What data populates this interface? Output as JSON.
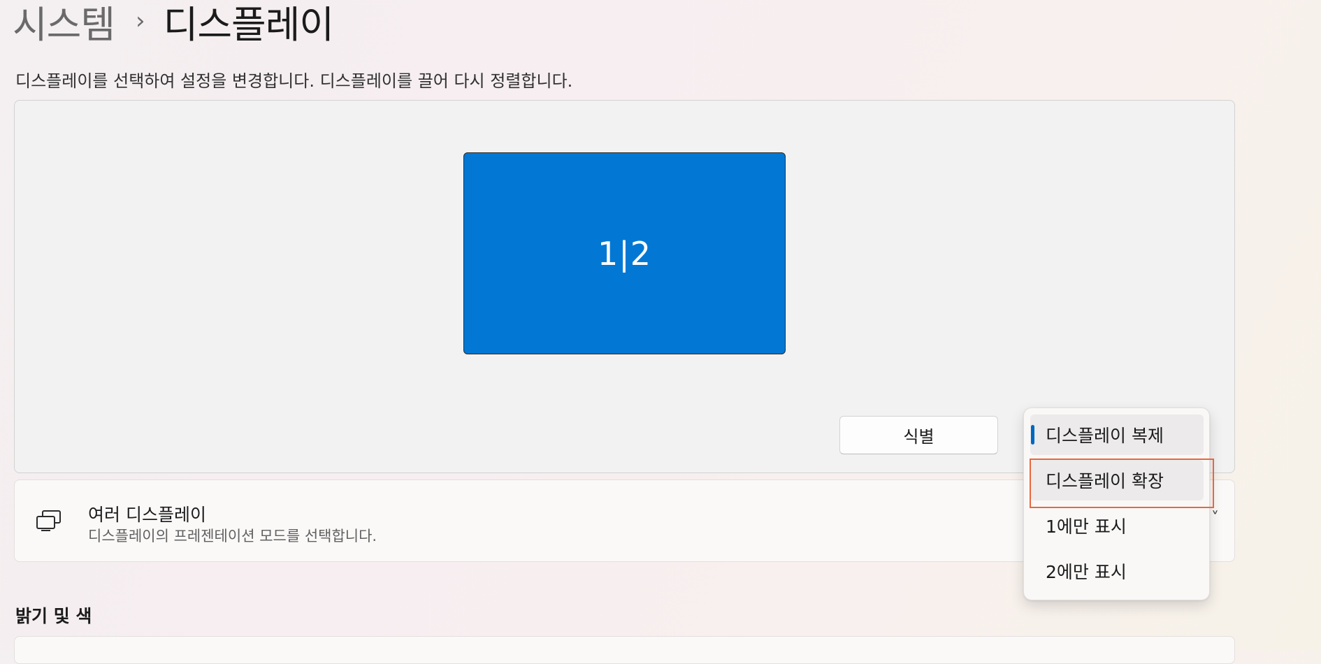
{
  "breadcrumb": {
    "parent": "시스템",
    "separator": "›",
    "current": "디스플레이"
  },
  "instructions": "디스플레이를 선택하여 설정을 변경합니다. 디스플레이를 끌어 다시 정렬합니다.",
  "arrangement": {
    "monitor_label": "1|2",
    "identify_button": "식별"
  },
  "multiple_displays": {
    "title": "여러 디스플레이",
    "description": "디스플레이의 프레젠테이션 모드를 선택합니다.",
    "icon": "multiple-displays-icon",
    "chevron": "˅"
  },
  "dropdown": {
    "options": [
      {
        "label": "디스플레이 복제",
        "selected": true
      },
      {
        "label": "디스플레이 확장",
        "selected": false,
        "highlighted": true
      },
      {
        "label": "1에만 표시",
        "selected": false
      },
      {
        "label": "2에만 표시",
        "selected": false
      }
    ]
  },
  "sections": {
    "brightness_color": "밝기 및 색"
  },
  "colors": {
    "accent": "#0067c0",
    "monitor_fill": "#0278d4",
    "highlight_outline": "#e8673d"
  }
}
